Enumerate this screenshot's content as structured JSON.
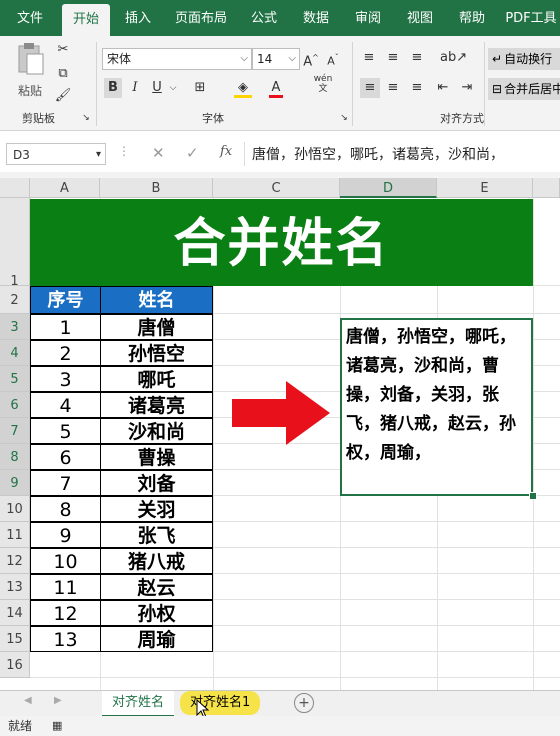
{
  "ribbon_tabs": [
    "文件",
    "开始",
    "插入",
    "页面布局",
    "公式",
    "数据",
    "审阅",
    "视图",
    "帮助",
    "PDF工具"
  ],
  "active_tab": "开始",
  "ribbon": {
    "paste_label": "粘贴",
    "clipboard_group": "剪贴板",
    "font_group": "字体",
    "align_group": "对齐方式",
    "font_name": "宋体",
    "font_size": "14",
    "wrap_text": "自动换行",
    "merge_center": "合并后居中",
    "phonetic": "wén"
  },
  "formula_bar": {
    "name_box": "D3",
    "fx": "fx",
    "content": "唐僧，孙悟空，哪吒，诸葛亮，沙和尚，"
  },
  "columns": [
    "A",
    "B",
    "C",
    "D",
    "E"
  ],
  "selected_column": "D",
  "rows": [
    "1",
    "2",
    "3",
    "4",
    "5",
    "6",
    "7",
    "8",
    "9",
    "10",
    "11",
    "12",
    "13",
    "14",
    "15",
    "16"
  ],
  "banner_title": "合并姓名",
  "table": {
    "headers": [
      "序号",
      "姓名"
    ],
    "rows": [
      [
        "1",
        "唐僧"
      ],
      [
        "2",
        "孙悟空"
      ],
      [
        "3",
        "哪吒"
      ],
      [
        "4",
        "诸葛亮"
      ],
      [
        "5",
        "沙和尚"
      ],
      [
        "6",
        "曹操"
      ],
      [
        "7",
        "刘备"
      ],
      [
        "8",
        "关羽"
      ],
      [
        "9",
        "张飞"
      ],
      [
        "10",
        "猪八戒"
      ],
      [
        "11",
        "赵云"
      ],
      [
        "12",
        "孙权"
      ],
      [
        "13",
        "周瑜"
      ]
    ]
  },
  "merged_cell_text": "唐僧，孙悟空，哪吒，诸葛亮，沙和尚，曹操，刘备，关羽，张飞，猪八戒，赵云，孙权，周瑜，",
  "sheet_tabs": [
    "对齐姓名",
    "对齐姓名1"
  ],
  "active_sheet": "对齐姓名",
  "status": "就绪",
  "colors": {
    "excel_green": "#217346",
    "banner_green": "#0a7f14",
    "header_blue": "#1a6fc4",
    "arrow_red": "#e8101a"
  }
}
